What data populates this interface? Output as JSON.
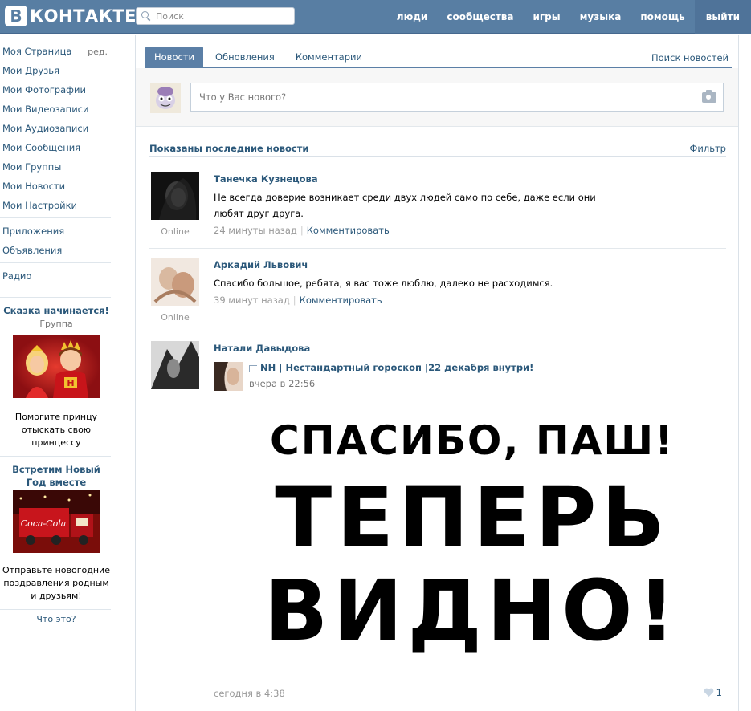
{
  "header": {
    "logo_letter": "В",
    "logo_text": "КОНТАКТЕ",
    "search_placeholder": "Поиск",
    "nav": [
      "люди",
      "сообщества",
      "игры",
      "музыка",
      "помощь"
    ],
    "exit_label": "выйти"
  },
  "leftmenu": {
    "items": [
      "Моя Страница",
      "Мои Друзья",
      "Мои Фотографии",
      "Мои Видеозаписи",
      "Мои Аудиозаписи",
      "Мои Сообщения",
      "Мои Группы",
      "Мои Новости",
      "Мои Настройки"
    ],
    "edit_label": "ред.",
    "items2": [
      "Приложения",
      "Объявления"
    ],
    "items3": [
      "Радио"
    ],
    "ad1": {
      "title": "Сказка начинается!",
      "subtitle": "Группа",
      "text": "Помогите принцу отыскать свою принцессу"
    },
    "ad2": {
      "title": "Встретим Новый Год вместе",
      "text": "Отправьте новогодние поздравления родным и друзьям!"
    },
    "what_is_this": "Что это?"
  },
  "main": {
    "tabs": [
      "Новости",
      "Обновления",
      "Комментарии"
    ],
    "news_search": "Поиск новостей",
    "composer_placeholder": "Что у Вас нового?",
    "feed_title": "Показаны последние новости",
    "filter_label": "Фильтр",
    "posts": [
      {
        "author": "Танечка Кузнецова",
        "text": "Не всегда доверие возникает среди двух людей само по себе, даже если они любят друг друга.",
        "time": "24 минуты назад",
        "comment_label": "Комментировать",
        "online": "Online"
      },
      {
        "author": "Аркадий Львович",
        "text": "Спасибо большое, ребята, я вас тоже люблю, далеко не расходимся.",
        "time": "39 минут назад",
        "comment_label": "Комментировать",
        "online": "Online"
      },
      {
        "author": "Натали Давыдова",
        "repost_title": "NH | Нестандартный гороскоп |22 декабря внутри!",
        "repost_time": "вчера в 22:56",
        "image_lines": [
          "СПАСИБО, ПАШ!",
          "ТЕПЕРЬ",
          "ВИДНО!"
        ],
        "time": "сегодня в 4:38",
        "likes": "1"
      }
    ]
  }
}
